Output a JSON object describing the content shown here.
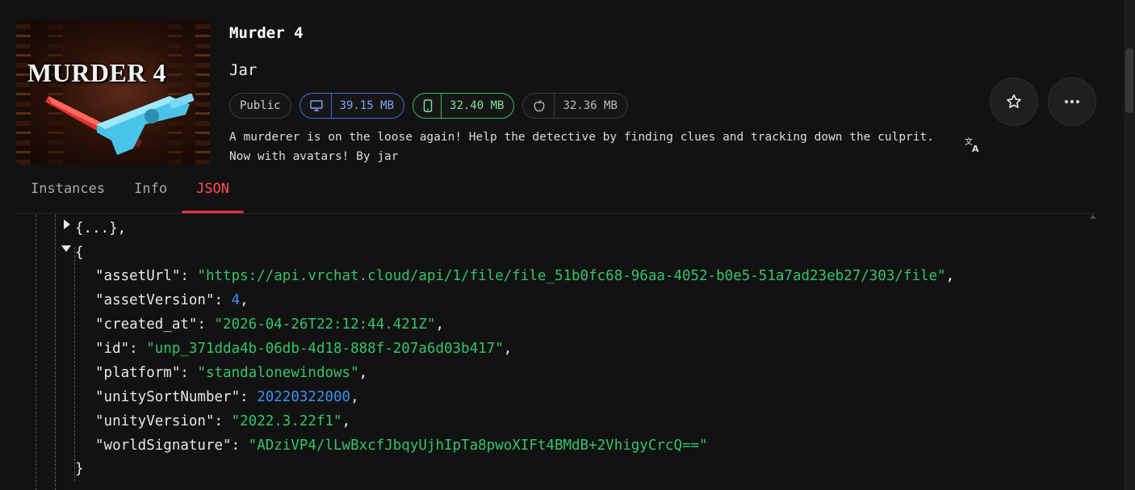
{
  "thumbnail": {
    "title": "MURDER 4"
  },
  "world": {
    "name": "Murder 4",
    "author": "Jar",
    "visibility": "Public",
    "sizes": {
      "pc": "39.15 MB",
      "android": "32.40 MB",
      "ios": "32.36 MB"
    },
    "description_line1": "A murderer is on the loose again! Help the detective by finding clues and tracking down the culprit.",
    "description_line2": "Now with avatars! By jar"
  },
  "icons": {
    "pc": "monitor-icon",
    "android": "phone-icon",
    "ios": "apple-icon",
    "translate": "translate-icon",
    "favorite": "star-icon",
    "more": "more-horizontal-icon"
  },
  "tabs": [
    {
      "label": "Instances",
      "active": false
    },
    {
      "label": "Info",
      "active": false
    },
    {
      "label": "JSON",
      "active": true
    }
  ],
  "json_view": {
    "collapsed_item": "{...},",
    "open_brace": "{",
    "close_brace": "}",
    "fields": [
      {
        "key": "\"assetUrl\"",
        "value": "\"https://api.vrchat.cloud/api/1/file/file_51b0fc68-96aa-4052-b0e5-51a7ad23eb27/303/file\"",
        "type": "string",
        "comma": ","
      },
      {
        "key": "\"assetVersion\"",
        "value": "4",
        "type": "number",
        "comma": ","
      },
      {
        "key": "\"created_at\"",
        "value": "\"2026-04-26T22:12:44.421Z\"",
        "type": "string",
        "comma": ","
      },
      {
        "key": "\"id\"",
        "value": "\"unp_371dda4b-06db-4d18-888f-207a6d03b417\"",
        "type": "string",
        "comma": ","
      },
      {
        "key": "\"platform\"",
        "value": "\"standalonewindows\"",
        "type": "string",
        "comma": ","
      },
      {
        "key": "\"unitySortNumber\"",
        "value": "20220322000",
        "type": "number",
        "comma": ","
      },
      {
        "key": "\"unityVersion\"",
        "value": "\"2022.3.22f1\"",
        "type": "string",
        "comma": ","
      },
      {
        "key": "\"worldSignature\"",
        "value": "\"ADziVP4/lLwBxcfJbqyUjhIpTa8pwoXIFt4BMdB+2VhigyCrcQ==\"",
        "type": "string",
        "comma": ""
      }
    ]
  },
  "colors": {
    "accent": "#e5323f",
    "json_string": "#34c46a",
    "json_number": "#3d8ff0",
    "pc": "#3b6fd8",
    "android": "#2fbf5a"
  }
}
